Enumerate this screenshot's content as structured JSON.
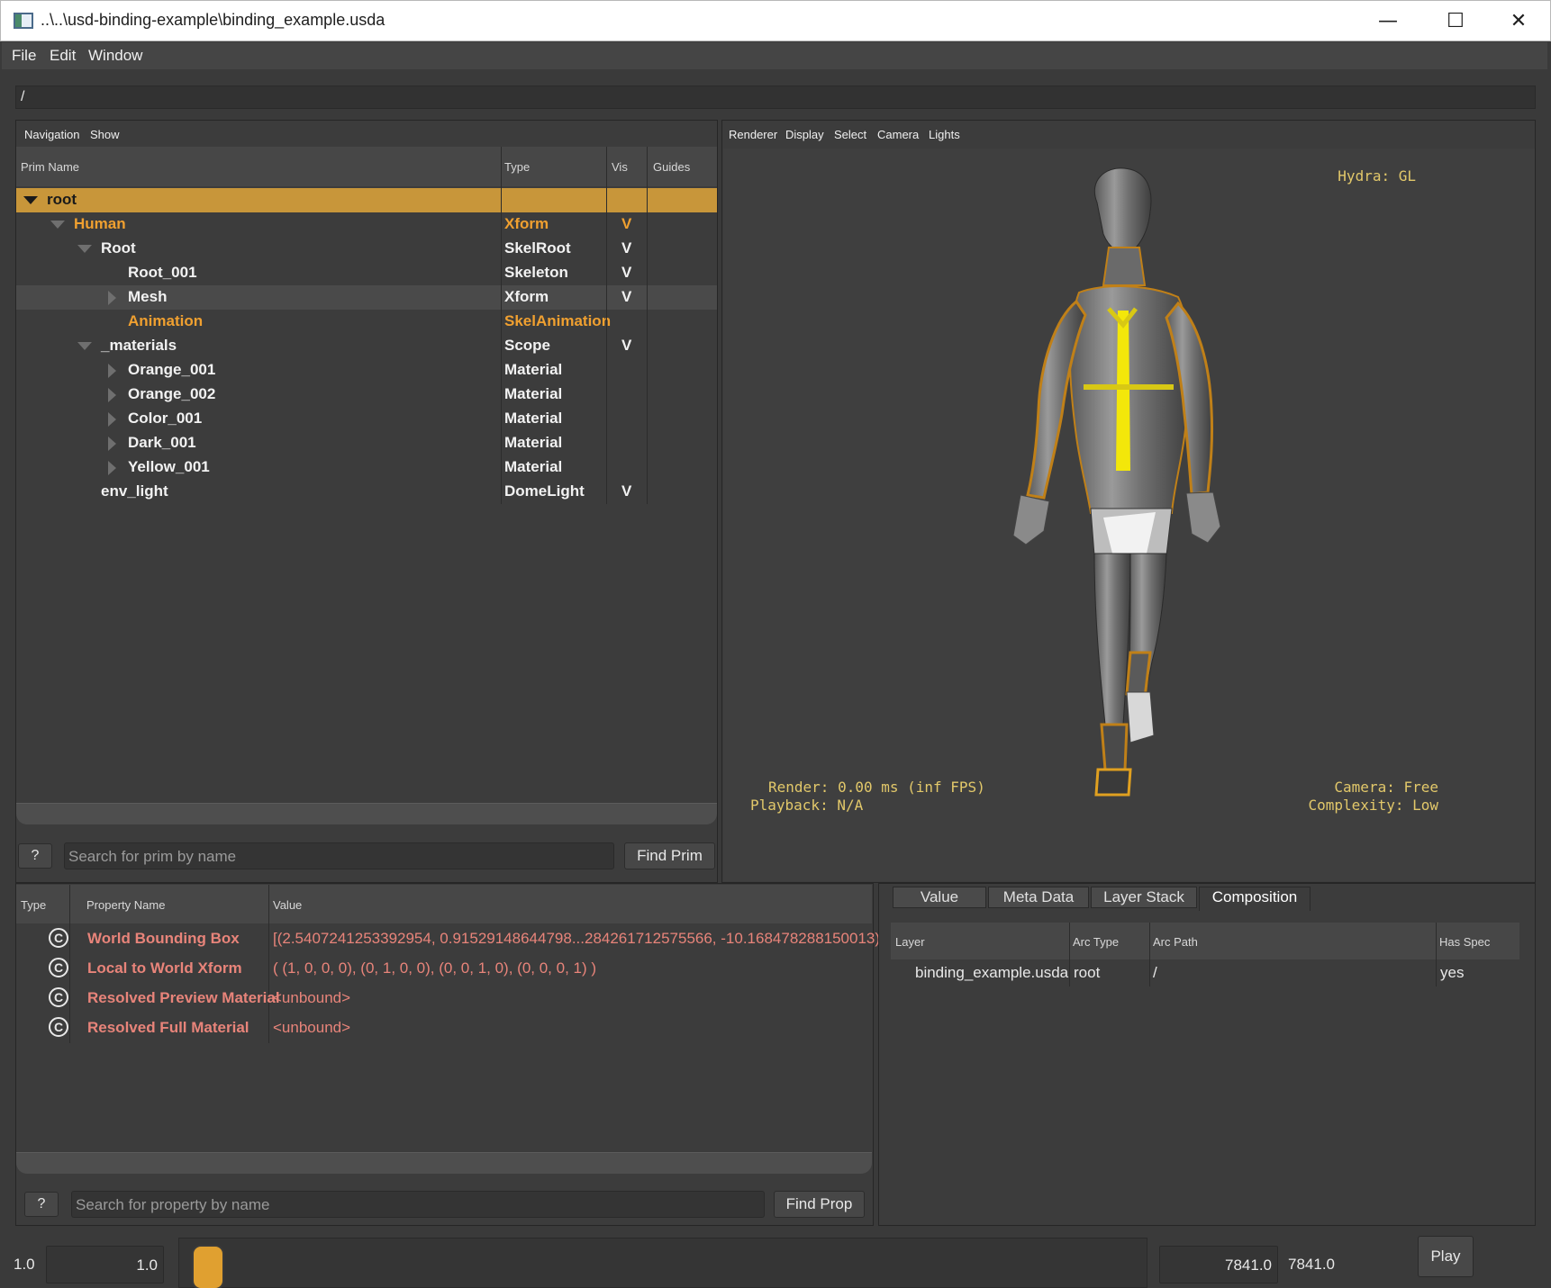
{
  "window": {
    "title": "..\\..\\usd-binding-example\\binding_example.usda",
    "minimize": "—",
    "maximize": "☐",
    "close": "✕"
  },
  "menu": [
    "File",
    "Edit",
    "Window"
  ],
  "path": "/",
  "prim_panel": {
    "toolbar": [
      "Navigation",
      "Show"
    ],
    "columns": [
      "Prim Name",
      "Type",
      "Vis",
      "Guides"
    ],
    "rows": [
      {
        "name": "root",
        "type": "",
        "vis": "",
        "depth": 0,
        "expander": "down",
        "style": "selected"
      },
      {
        "name": "Human",
        "type": "Xform",
        "vis": "V",
        "depth": 1,
        "expander": "down",
        "style": "highlight"
      },
      {
        "name": "Root",
        "type": "SkelRoot",
        "vis": "V",
        "depth": 2,
        "expander": "down",
        "style": "normal"
      },
      {
        "name": "Root_001",
        "type": "Skeleton",
        "vis": "V",
        "depth": 3,
        "expander": "none",
        "style": "normal"
      },
      {
        "name": "Mesh",
        "type": "Xform",
        "vis": "V",
        "depth": 3,
        "expander": "right",
        "style": "hover"
      },
      {
        "name": "Animation",
        "type": "SkelAnimation",
        "vis": "",
        "depth": 3,
        "expander": "none",
        "style": "highlight"
      },
      {
        "name": "_materials",
        "type": "Scope",
        "vis": "V",
        "depth": 2,
        "expander": "down",
        "style": "normal"
      },
      {
        "name": "Orange_001",
        "type": "Material",
        "vis": "",
        "depth": 3,
        "expander": "right",
        "style": "normal"
      },
      {
        "name": "Orange_002",
        "type": "Material",
        "vis": "",
        "depth": 3,
        "expander": "right",
        "style": "normal"
      },
      {
        "name": "Color_001",
        "type": "Material",
        "vis": "",
        "depth": 3,
        "expander": "right",
        "style": "normal"
      },
      {
        "name": "Dark_001",
        "type": "Material",
        "vis": "",
        "depth": 3,
        "expander": "right",
        "style": "normal"
      },
      {
        "name": "Yellow_001",
        "type": "Material",
        "vis": "",
        "depth": 3,
        "expander": "right",
        "style": "normal"
      },
      {
        "name": "env_light",
        "type": "DomeLight",
        "vis": "V",
        "depth": 2,
        "expander": "none",
        "style": "normal"
      }
    ],
    "help_button": "?",
    "search_placeholder": "Search for prim by name",
    "find_button": "Find Prim"
  },
  "viewport": {
    "toolbar": [
      "Renderer",
      "Display",
      "Select",
      "Camera",
      "Lights"
    ],
    "hud_renderer": "Hydra: GL",
    "hud_render": "Render: 0.00 ms (inf FPS)",
    "hud_playback": "Playback: N/A",
    "hud_camera": "Camera: Free",
    "hud_complexity": "Complexity: Low"
  },
  "property_panel": {
    "columns": [
      "Type",
      "Property Name",
      "Value"
    ],
    "rows": [
      {
        "icon": "C",
        "name": "World Bounding Box",
        "value": "[(2.5407241253392954, 0.91529148644798...284261712575566, -10.168478288150013)]"
      },
      {
        "icon": "C",
        "name": "Local to World Xform",
        "value": "( (1, 0, 0, 0), (0, 1, 0, 0), (0, 0, 1, 0), (0, 0, 0, 1) )"
      },
      {
        "icon": "C",
        "name": "Resolved Preview Material",
        "value": "<unbound>"
      },
      {
        "icon": "C",
        "name": "Resolved Full Material",
        "value": "<unbound>"
      }
    ],
    "help_button": "?",
    "search_placeholder": "Search for property by name",
    "find_button": "Find Prop"
  },
  "composition_panel": {
    "tabs": [
      "Value",
      "Meta Data",
      "Layer Stack",
      "Composition"
    ],
    "active_tab": "Composition",
    "columns": [
      "Layer",
      "Arc Type",
      "Arc Path",
      "Has Spec"
    ],
    "rows": [
      {
        "layer": "binding_example.usda",
        "arc_type": "root",
        "arc_path": "/",
        "has_spec": "yes"
      }
    ]
  },
  "timeline": {
    "start_label": "1.0",
    "start_field": "1.0",
    "end_field": "7841.0",
    "end_label": "7841.0",
    "play_button": "Play"
  },
  "colors": {
    "highlight": "#f0a030",
    "selection_row": "#c8963a",
    "property_text": "#e8847a",
    "hud_text": "#e2c86a"
  }
}
